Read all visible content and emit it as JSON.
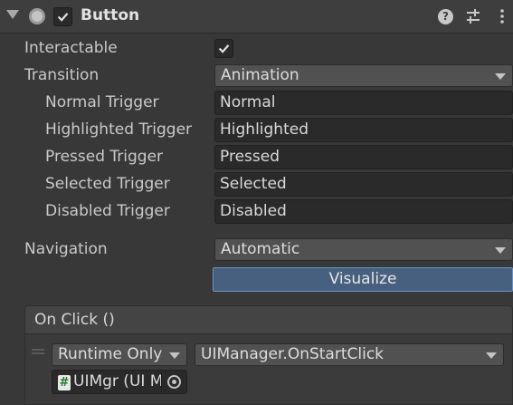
{
  "component": {
    "title": "Button",
    "enabled": true,
    "icons": [
      "foldout-arrow",
      "button-component-icon",
      "help-icon",
      "preset-icon",
      "kebab-menu-icon"
    ]
  },
  "properties": {
    "interactable_label": "Interactable",
    "interactable_checked": true,
    "transition_label": "Transition",
    "transition_value": "Animation",
    "triggers": [
      {
        "label": "Normal Trigger",
        "value": "Normal"
      },
      {
        "label": "Highlighted Trigger",
        "value": "Highlighted"
      },
      {
        "label": "Pressed Trigger",
        "value": "Pressed"
      },
      {
        "label": "Selected Trigger",
        "value": "Selected"
      },
      {
        "label": "Disabled Trigger",
        "value": "Disabled"
      }
    ],
    "navigation_label": "Navigation",
    "navigation_value": "Automatic",
    "visualize_label": "Visualize"
  },
  "on_click": {
    "header": "On Click ()",
    "runtime_value": "Runtime Only",
    "function_value": "UIManager.OnStartClick",
    "object_value": "UIMgr (UI M"
  },
  "colors": {
    "background": "#383838",
    "accent": "#47607f",
    "accent_border": "#6a92c2"
  }
}
